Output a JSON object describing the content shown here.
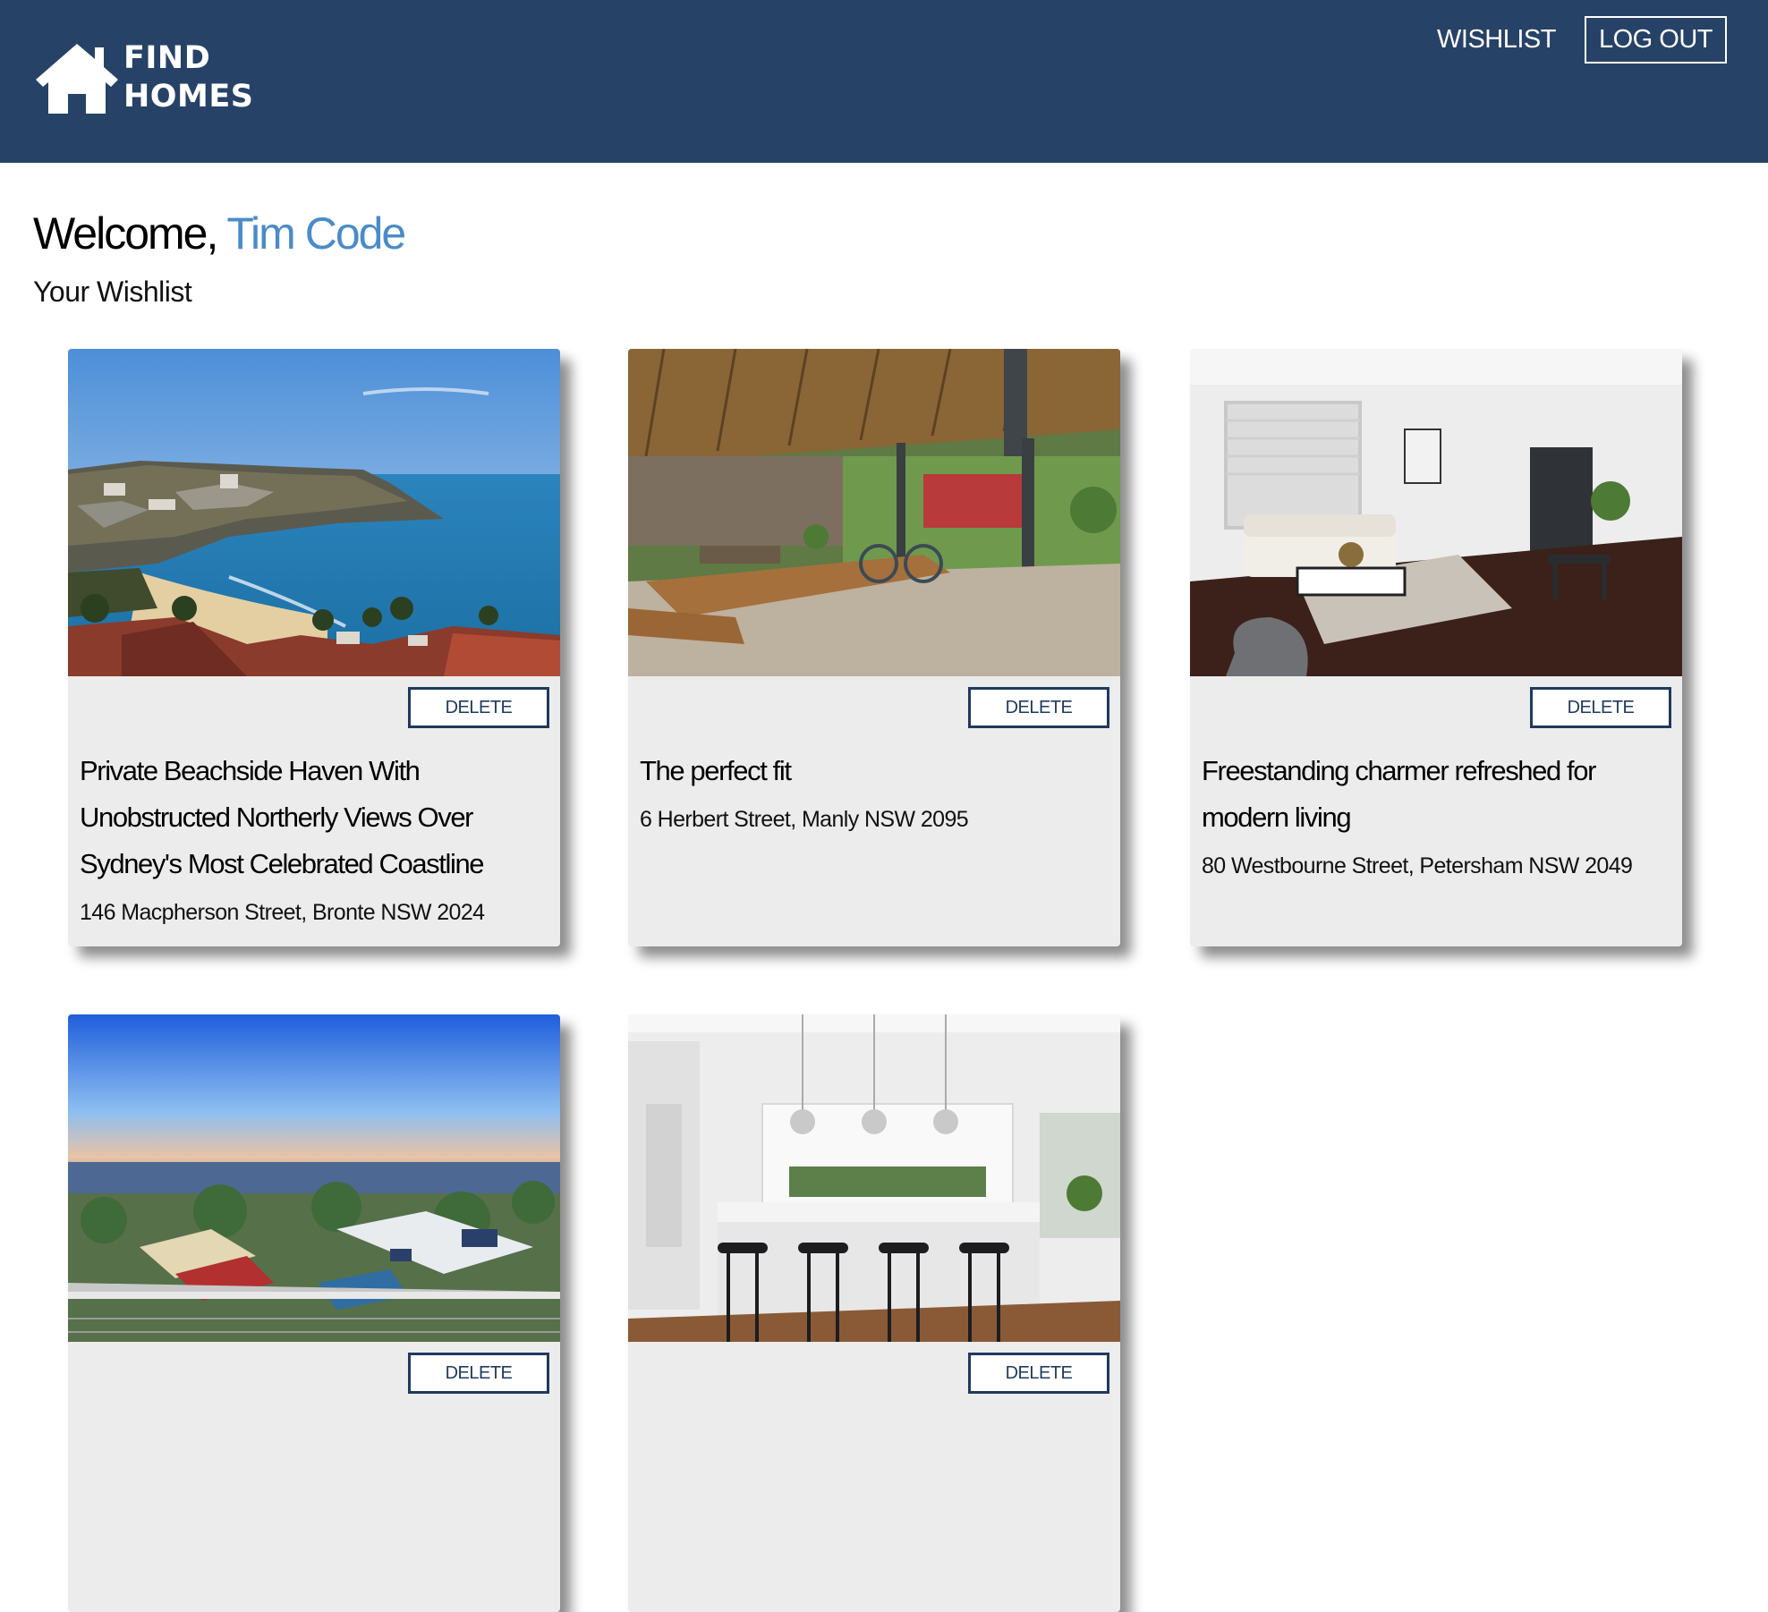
{
  "header": {
    "logo_line1": "FIND",
    "logo_line2": "HOMES",
    "nav_wishlist": "WISHLIST",
    "nav_logout": "LOG OUT"
  },
  "welcome": {
    "greeting": "Welcome,",
    "user_name": "Tim Code",
    "subtitle": "Your Wishlist"
  },
  "colors": {
    "header_bg": "#274267",
    "accent_name": "#4a8bc9",
    "card_bg": "#ececec",
    "button_border": "#1f3a5c"
  },
  "listings": [
    {
      "image": "coastal beach view",
      "delete_label": "DELETE",
      "title": "Private Beachside Haven With Unobstructed Northerly Views Over Sydney's Most Celebrated Coastline",
      "address": "146 Macpherson Street, Bronte NSW 2024"
    },
    {
      "image": "covered outdoor patio",
      "delete_label": "DELETE",
      "title": "The perfect fit",
      "address": "6 Herbert Street, Manly NSW 2095"
    },
    {
      "image": "bright living room",
      "delete_label": "DELETE",
      "title": "Freestanding charmer refreshed for modern living",
      "address": "80 Westbourne Street, Petersham NSW 2049"
    },
    {
      "image": "harbour sunset view",
      "delete_label": "DELETE",
      "title": "",
      "address": ""
    },
    {
      "image": "white kitchen with island",
      "delete_label": "DELETE",
      "title": "",
      "address": ""
    }
  ]
}
